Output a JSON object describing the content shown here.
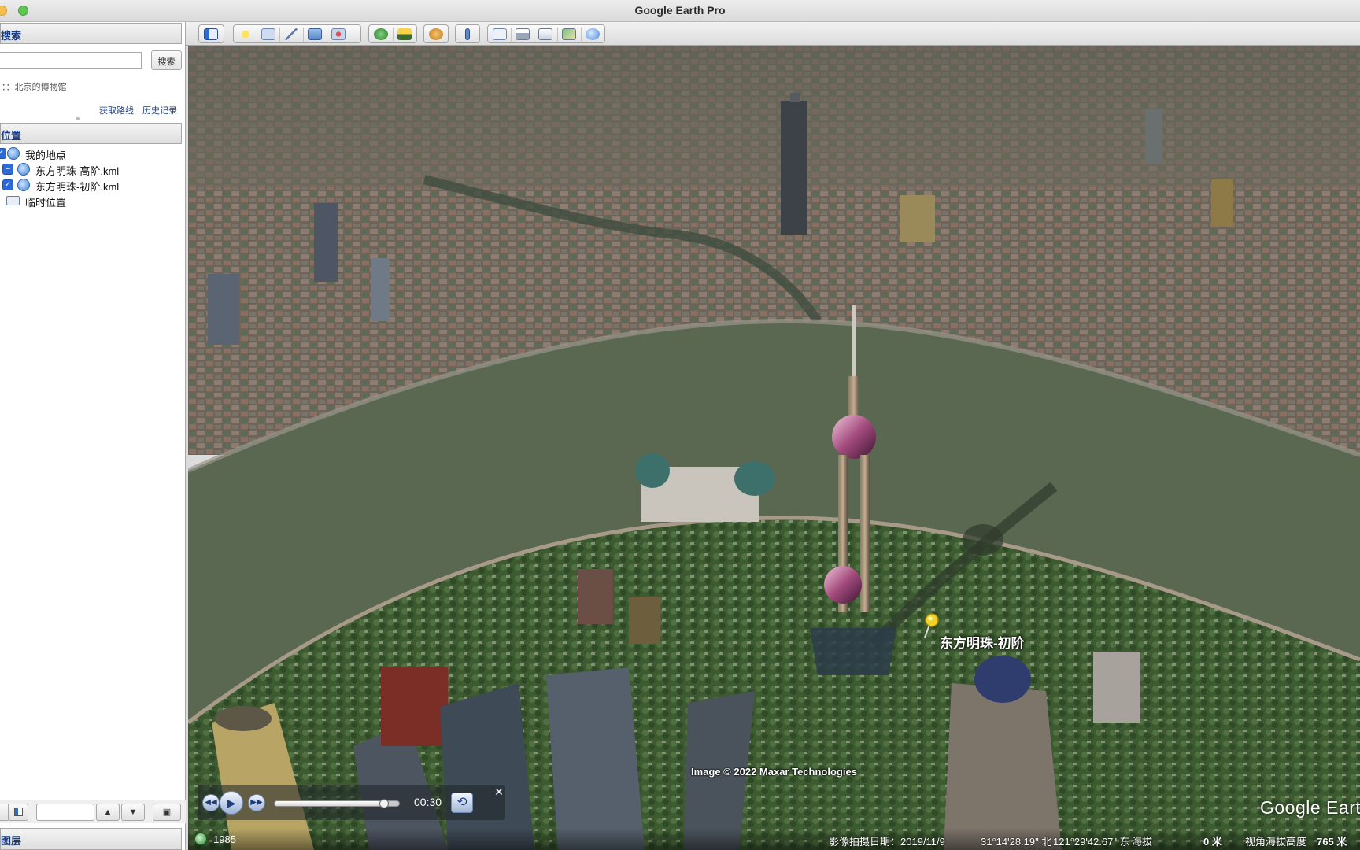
{
  "window": {
    "title": "Google Earth Pro"
  },
  "search": {
    "header": "搜索",
    "input_value": "",
    "button_label": "搜索",
    "hint": "：：北京的博物馆",
    "route_link": "获取路线",
    "history_link": "历史记录"
  },
  "places": {
    "header": "位置",
    "items": [
      {
        "label": "我的地点",
        "checked": true
      },
      {
        "label": "东方明珠-高阶.kml",
        "checked": true
      },
      {
        "label": "东方明珠-初阶.kml",
        "checked": true
      },
      {
        "label": "临时位置",
        "checked": false
      }
    ]
  },
  "layers": {
    "header": "图层"
  },
  "sidebar_bottom": {
    "up_arrow": "▲",
    "down_arrow": "▼"
  },
  "toolbar": {
    "buttons": [
      "sidebar-toggle-icon",
      "placemark-icon",
      "polygon-icon",
      "path-icon",
      "image-overlay-icon",
      "record-tour-icon",
      "historical-imagery-icon",
      "sunlight-icon",
      "planets-icon",
      "ruler-icon",
      "email-icon",
      "print-icon",
      "save-image-icon",
      "google-maps-icon",
      "earth-icon"
    ]
  },
  "map": {
    "attribution": "Image © 2022 Maxar Technologies",
    "logo_text": "Google Earth",
    "placemark_label": "东方明珠-初阶"
  },
  "tour": {
    "time": "00:30",
    "progress": 0.88,
    "close": "✕",
    "prev": "◀◀",
    "play": "▶",
    "next": "▶▶",
    "repeat": "⟲"
  },
  "status": {
    "year": "1985",
    "imagery_date": "影像拍摄日期：2019/11/9",
    "lat": "31°14'28.19\" 北",
    "lon": "121°29'42.67\" 东",
    "elev_label": "海拔",
    "elev_value": "0 米",
    "eye_label": "视角海拔高度",
    "eye_value": "765 米"
  },
  "colors": {
    "accent": "#1a3d80",
    "checkbox": "#2a6bd8",
    "river": "#5a6852",
    "pin": "#f2d22a"
  }
}
